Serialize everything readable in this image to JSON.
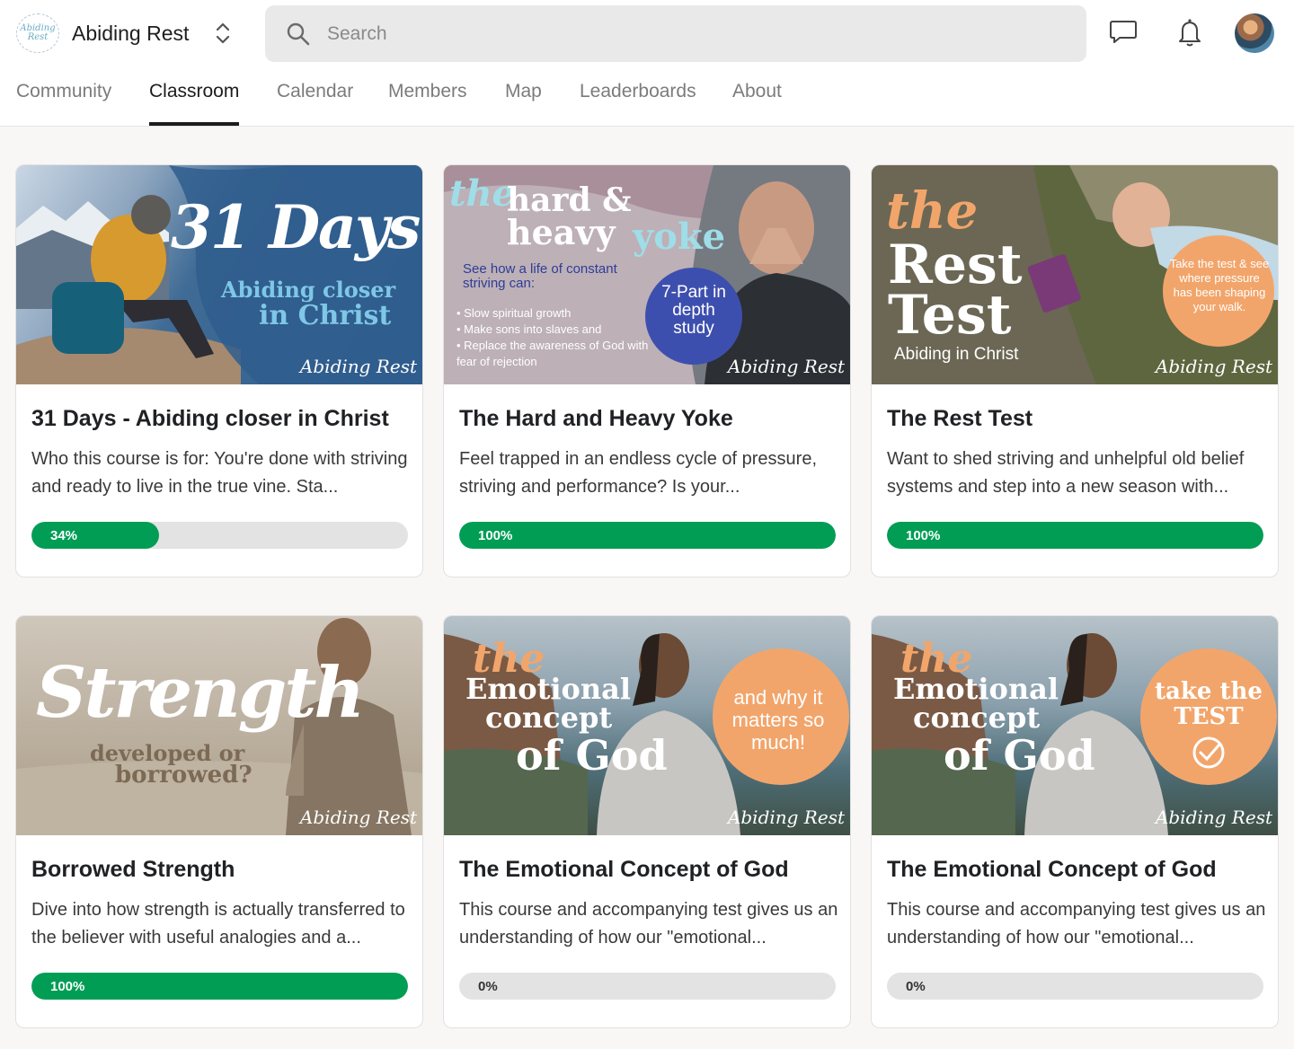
{
  "header": {
    "brand_name": "Abiding Rest",
    "logo_text": "Abiding Rest",
    "search_placeholder": "Search"
  },
  "tabs": [
    {
      "label": "Community",
      "active": false
    },
    {
      "label": "Classroom",
      "active": true
    },
    {
      "label": "Calendar",
      "active": false
    },
    {
      "label": "Members",
      "active": false
    },
    {
      "label": "Map",
      "active": false
    },
    {
      "label": "Leaderboards",
      "active": false
    },
    {
      "label": "About",
      "active": false
    }
  ],
  "courses": [
    {
      "title": "31 Days - Abiding closer in Christ",
      "description": "Who this course is for: You're done with striving and ready to live in the true vine. Sta...",
      "progress": 34,
      "progress_label": "34%",
      "cover": {
        "line1": "31 Days",
        "line2": "Abiding closer",
        "line3": "in Christ",
        "signature": "Abiding Rest"
      }
    },
    {
      "title": "The Hard and Heavy Yoke",
      "description": "Feel trapped in an endless cycle of pressure, striving and performance? Is your...",
      "progress": 100,
      "progress_label": "100%",
      "cover": {
        "line1": "the",
        "line2": "hard &",
        "line3": "heavy",
        "line4": "yoke",
        "sub": "See how a life of constant striving can:",
        "bullets": [
          "Slow spiritual growth",
          "Make sons into slaves and",
          "Replace the awareness of God with fear of rejection"
        ],
        "badge": "7-Part in depth study",
        "signature": "Abiding Rest"
      }
    },
    {
      "title": "The Rest Test",
      "description": "Want to shed striving and unhelpful old belief systems and step into a new season with...",
      "progress": 100,
      "progress_label": "100%",
      "cover": {
        "line1": "the",
        "line2": "Rest",
        "line3": "Test",
        "sub": "Abiding in Christ",
        "badge": "Take the test & see where pressure has been shaping your walk.",
        "signature": "Abiding Rest"
      }
    },
    {
      "title": "Borrowed Strength",
      "description": "Dive into how strength is actually transferred to the believer with useful analogies and a...",
      "progress": 100,
      "progress_label": "100%",
      "cover": {
        "line1": "Strength",
        "line2": "developed or",
        "line3": "borrowed?",
        "signature": "Abiding Rest"
      }
    },
    {
      "title": "The Emotional Concept of God",
      "description": "This course and accompanying test gives us an understanding of how our \"emotional...",
      "progress": 0,
      "progress_label": "0%",
      "cover": {
        "line1": "the",
        "line2": "Emotional",
        "line3": "concept",
        "line4": "of God",
        "badge": "and why it matters so much!",
        "signature": "Abiding Rest"
      }
    },
    {
      "title": "The Emotional Concept of God",
      "description": "This course and accompanying test gives us an understanding of how our \"emotional...",
      "progress": 0,
      "progress_label": "0%",
      "cover": {
        "line1": "the",
        "line2": "Emotional",
        "line3": "concept",
        "line4": "of God",
        "badge": "take the TEST",
        "signature": "Abiding Rest"
      }
    }
  ],
  "colors": {
    "progress_fill": "#019d55",
    "progress_track": "#e3e3e3",
    "accent_orange": "#f2a56b",
    "accent_cyan": "#9fdde8"
  }
}
